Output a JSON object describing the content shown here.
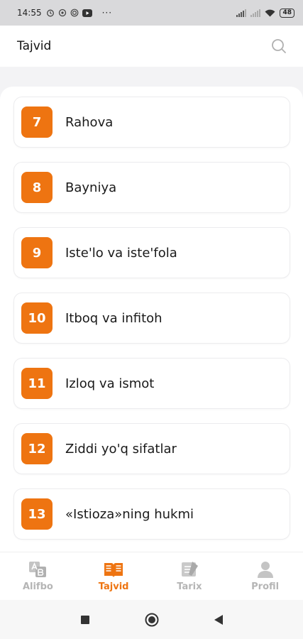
{
  "status_bar": {
    "time": "14:55",
    "icons": [
      "alarm-icon",
      "settings-icon",
      "radio-icon",
      "youtube-icon"
    ],
    "dots": "···",
    "battery": "48"
  },
  "header": {
    "title": "Tajvid"
  },
  "lessons": [
    {
      "number": "7",
      "title": "Rahova"
    },
    {
      "number": "8",
      "title": "Bayniya"
    },
    {
      "number": "9",
      "title": "Iste'lo va iste'fola"
    },
    {
      "number": "10",
      "title": "Itboq va infitoh"
    },
    {
      "number": "11",
      "title": "Izloq va ismot"
    },
    {
      "number": "12",
      "title": "Ziddi yo'q sifatlar"
    },
    {
      "number": "13",
      "title": "«Istioza»ning hukmi"
    }
  ],
  "bottom_nav": [
    {
      "label": "Alifbo",
      "icon": "alphabet-icon",
      "active": false
    },
    {
      "label": "Tajvid",
      "icon": "book-icon",
      "active": true
    },
    {
      "label": "Tarix",
      "icon": "scroll-icon",
      "active": false
    },
    {
      "label": "Profil",
      "icon": "user-icon",
      "active": false
    }
  ],
  "colors": {
    "accent": "#ee7411",
    "inactive": "#b5b5b5",
    "background": "#f3f3f5"
  }
}
